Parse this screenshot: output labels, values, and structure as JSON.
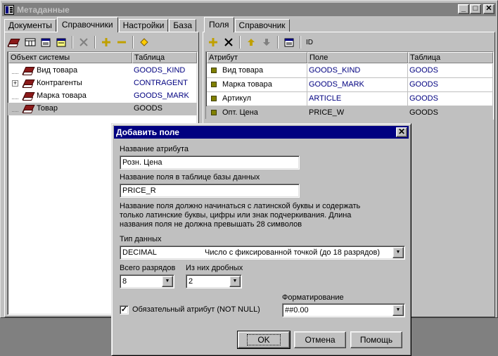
{
  "window": {
    "title": "Метаданные",
    "btn_min": "_",
    "btn_max": "□",
    "btn_close": "✕"
  },
  "left": {
    "tabs": [
      {
        "label": "Документы",
        "active": false
      },
      {
        "label": "Справочники",
        "active": true
      },
      {
        "label": "Настройки",
        "active": false
      },
      {
        "label": "База",
        "active": false
      }
    ],
    "toolbar_icons": [
      "book-icon",
      "table-icon",
      "properties-icon",
      "properties2-icon",
      "delete-icon",
      "add-icon",
      "remove-icon",
      "diamond-icon"
    ],
    "columns": [
      "Объект системы",
      "Таблица"
    ],
    "rows": [
      {
        "name": "Вид товара",
        "table": "GOODS_KIND",
        "expand": "",
        "selected": false
      },
      {
        "name": "Контрагенты",
        "table": "CONTRAGENT",
        "expand": "+",
        "selected": false
      },
      {
        "name": "Марка товара",
        "table": "GOODS_MARK",
        "expand": "",
        "selected": false
      },
      {
        "name": "Товар",
        "table": "GOODS",
        "expand": "",
        "selected": true
      }
    ]
  },
  "right": {
    "tabs": [
      {
        "label": "Поля",
        "active": true
      },
      {
        "label": "Справочник",
        "active": false
      }
    ],
    "toolbar_id_label": "ID",
    "columns": [
      "Атрибут",
      "Поле",
      "Таблица"
    ],
    "rows": [
      {
        "attr": "Вид товара",
        "field": "GOODS_KIND",
        "table": "GOODS",
        "selected": false
      },
      {
        "attr": "Марка товара",
        "field": "GOODS_MARK",
        "table": "GOODS",
        "selected": false
      },
      {
        "attr": "Артикул",
        "field": "ARTICLE",
        "table": "GOODS",
        "selected": false
      },
      {
        "attr": "Опт. Цена",
        "field": "PRICE_W",
        "table": "GOODS",
        "selected": true
      }
    ]
  },
  "dialog": {
    "title": "Добавить поле",
    "close": "✕",
    "attr_name_label": "Название атрибута",
    "attr_name_value": "Розн. Цена",
    "field_name_label": "Название поля в таблице базы данных",
    "field_name_value": "PRICE_R",
    "hint_lines": [
      "Название поля должно начинаться с латинской буквы и содержать",
      "только латинские буквы, цифры или знак подчеркивания. Длина",
      "названия поля не должна превышать 28 символов"
    ],
    "data_type_label": "Тип данных",
    "data_type_value": "DECIMAL",
    "data_type_desc": "Число с фиксированной точкой (до 18 разрядов)",
    "digits_label": "Всего разрядов",
    "digits_value": "8",
    "fraction_label": "Из них дробных",
    "fraction_value": "2",
    "format_label": "Форматирование",
    "format_value": "##0.00",
    "notnull_label": "Обязательный атрибут (NOT NULL)",
    "notnull_checked": true,
    "ok": "OK",
    "cancel": "Отмена",
    "help": "Помощь"
  }
}
